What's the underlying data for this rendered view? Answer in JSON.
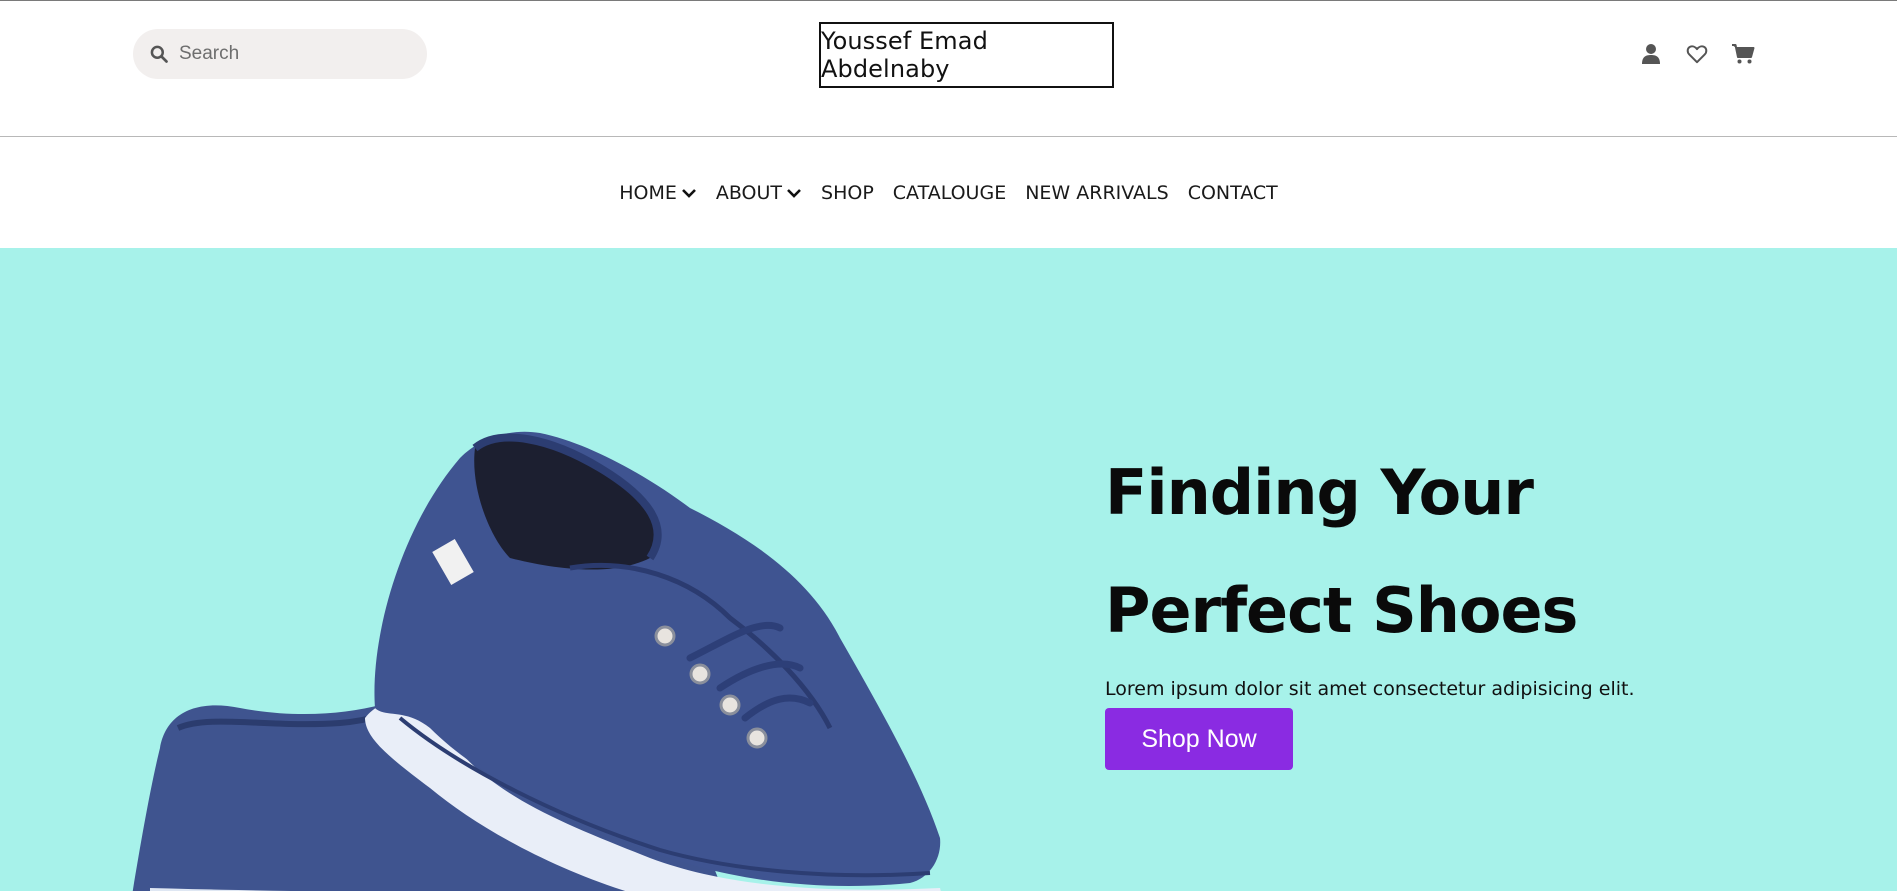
{
  "header": {
    "search": {
      "placeholder": "Search",
      "value": ""
    },
    "logo_text": "Youssef Emad Abdelnaby",
    "icons": [
      "user-icon",
      "heart-icon",
      "cart-icon"
    ]
  },
  "nav": {
    "items": [
      {
        "label": "HOME",
        "has_dropdown": true
      },
      {
        "label": "ABOUT",
        "has_dropdown": true
      },
      {
        "label": "SHOP",
        "has_dropdown": false
      },
      {
        "label": "CATALOUGE",
        "has_dropdown": false
      },
      {
        "label": "NEW ARRIVALS",
        "has_dropdown": false
      },
      {
        "label": "CONTACT",
        "has_dropdown": false
      }
    ]
  },
  "hero": {
    "title_line1": "Finding Your",
    "title_line2": "Perfect Shoes",
    "subtitle": "Lorem ipsum dolor sit amet consectetur adipisicing elit.",
    "cta_label": "Shop Now",
    "background_color": "#a7f2ea",
    "cta_color": "#8a2be2"
  }
}
